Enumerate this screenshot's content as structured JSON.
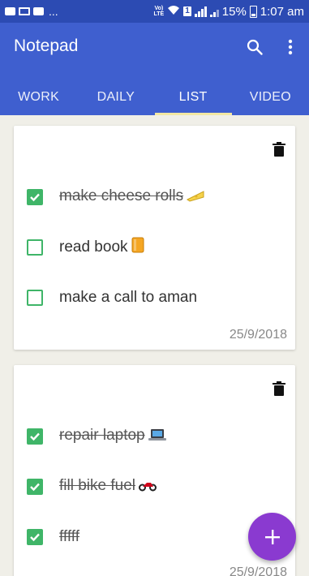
{
  "status_bar": {
    "dots": "...",
    "volte_top": "Vo)",
    "volte_bottom": "LTE",
    "sim": "1",
    "battery_percent": "15%",
    "time": "1:07 am"
  },
  "app_bar": {
    "title": "Notepad",
    "search_icon": "search-icon",
    "more_icon": "more-vert-icon"
  },
  "tabs": [
    {
      "label": "WORK",
      "active": false
    },
    {
      "label": "DAILY",
      "active": false
    },
    {
      "label": "LIST",
      "active": true
    },
    {
      "label": "VIDEO",
      "active": false
    }
  ],
  "cards": [
    {
      "items": [
        {
          "text": "make cheese rolls",
          "checked": true,
          "icon": "cheese-emoji"
        },
        {
          "text": "read book",
          "checked": false,
          "icon": "book-emoji"
        },
        {
          "text": "make a call to aman",
          "checked": false,
          "icon": ""
        }
      ],
      "date": "25/9/2018"
    },
    {
      "items": [
        {
          "text": "repair laptop",
          "checked": true,
          "icon": "laptop-emoji"
        },
        {
          "text": "fill bike fuel",
          "checked": true,
          "icon": "motorbike-emoji"
        },
        {
          "text": "fffff",
          "checked": true,
          "icon": ""
        }
      ],
      "date": "25/9/2018"
    }
  ],
  "fab": {
    "label": "+"
  },
  "colors": {
    "status_bar": "#2c4bb3",
    "app_bar": "#3f5fcf",
    "tab_indicator": "#f3e7a3",
    "checkbox": "#3fb568",
    "fab": "#8a3ad0",
    "background": "#f0efe8"
  }
}
